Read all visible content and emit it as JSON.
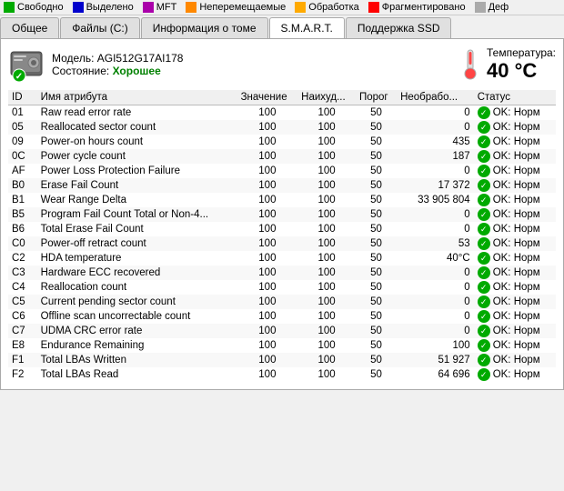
{
  "legend": [
    {
      "color": "#00aa00",
      "label": "Свободно"
    },
    {
      "color": "#0000ff",
      "label": "Выделено"
    },
    {
      "color": "#aa00aa",
      "label": "MFT"
    },
    {
      "color": "#ff8800",
      "label": "Неперемещаемые"
    },
    {
      "color": "#ffaa00",
      "label": "Обработка"
    },
    {
      "color": "#ff0000",
      "label": "Фрагментировано"
    },
    {
      "color": "#888888",
      "label": "Деф"
    }
  ],
  "tabs": [
    {
      "label": "Общее"
    },
    {
      "label": "Файлы (С:)"
    },
    {
      "label": "Информация о томе"
    },
    {
      "label": "S.M.A.R.T.",
      "active": true
    },
    {
      "label": "Поддержка SSD"
    }
  ],
  "device": {
    "model_label": "Модель:",
    "model": "AGI512G17AI178",
    "status_label": "Состояние:",
    "status": "Хорошее",
    "temp_label": "Температура:",
    "temp_value": "40 °C"
  },
  "table": {
    "headers": [
      "ID",
      "Имя атрибута",
      "Значение",
      "Наихуд...",
      "Порог",
      "Необрабо...",
      "Статус"
    ],
    "rows": [
      {
        "id": "01",
        "name": "Raw read error rate",
        "value": "100",
        "worst": "100",
        "thresh": "50",
        "raw": "0",
        "status": "OK: Норм"
      },
      {
        "id": "05",
        "name": "Reallocated sector count",
        "value": "100",
        "worst": "100",
        "thresh": "50",
        "raw": "0",
        "status": "OK: Норм"
      },
      {
        "id": "09",
        "name": "Power-on hours count",
        "value": "100",
        "worst": "100",
        "thresh": "50",
        "raw": "435",
        "status": "OK: Норм"
      },
      {
        "id": "0C",
        "name": "Power cycle count",
        "value": "100",
        "worst": "100",
        "thresh": "50",
        "raw": "187",
        "status": "OK: Норм"
      },
      {
        "id": "AF",
        "name": "Power Loss Protection Failure",
        "value": "100",
        "worst": "100",
        "thresh": "50",
        "raw": "0",
        "status": "OK: Норм"
      },
      {
        "id": "B0",
        "name": "Erase Fail Count",
        "value": "100",
        "worst": "100",
        "thresh": "50",
        "raw": "17 372",
        "status": "OK: Норм"
      },
      {
        "id": "B1",
        "name": "Wear Range Delta",
        "value": "100",
        "worst": "100",
        "thresh": "50",
        "raw": "33 905 804",
        "status": "OK: Норм"
      },
      {
        "id": "B5",
        "name": "Program Fail Count Total or Non-4...",
        "value": "100",
        "worst": "100",
        "thresh": "50",
        "raw": "0",
        "status": "OK: Норм"
      },
      {
        "id": "B6",
        "name": "Total Erase Fail Count",
        "value": "100",
        "worst": "100",
        "thresh": "50",
        "raw": "0",
        "status": "OK: Норм"
      },
      {
        "id": "C0",
        "name": "Power-off retract count",
        "value": "100",
        "worst": "100",
        "thresh": "50",
        "raw": "53",
        "status": "OK: Норм"
      },
      {
        "id": "C2",
        "name": "HDA temperature",
        "value": "100",
        "worst": "100",
        "thresh": "50",
        "raw": "40°C",
        "status": "OK: Норм"
      },
      {
        "id": "C3",
        "name": "Hardware ECC recovered",
        "value": "100",
        "worst": "100",
        "thresh": "50",
        "raw": "0",
        "status": "OK: Норм"
      },
      {
        "id": "C4",
        "name": "Reallocation count",
        "value": "100",
        "worst": "100",
        "thresh": "50",
        "raw": "0",
        "status": "OK: Норм"
      },
      {
        "id": "C5",
        "name": "Current pending sector count",
        "value": "100",
        "worst": "100",
        "thresh": "50",
        "raw": "0",
        "status": "OK: Норм"
      },
      {
        "id": "C6",
        "name": "Offline scan uncorrectable count",
        "value": "100",
        "worst": "100",
        "thresh": "50",
        "raw": "0",
        "status": "OK: Норм"
      },
      {
        "id": "C7",
        "name": "UDMA CRC error rate",
        "value": "100",
        "worst": "100",
        "thresh": "50",
        "raw": "0",
        "status": "OK: Норм"
      },
      {
        "id": "E8",
        "name": "Endurance Remaining",
        "value": "100",
        "worst": "100",
        "thresh": "50",
        "raw": "100",
        "status": "OK: Норм"
      },
      {
        "id": "F1",
        "name": "Total LBAs Written",
        "value": "100",
        "worst": "100",
        "thresh": "50",
        "raw": "51 927",
        "status": "OK: Норм"
      },
      {
        "id": "F2",
        "name": "Total LBAs Read",
        "value": "100",
        "worst": "100",
        "thresh": "50",
        "raw": "64 696",
        "status": "OK: Норм"
      }
    ]
  }
}
